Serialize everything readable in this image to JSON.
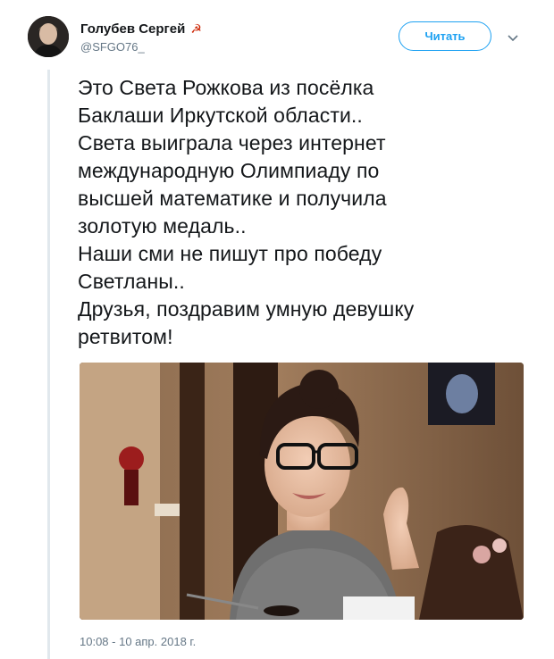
{
  "author": {
    "name": "Голубев Сергей",
    "name_symbol": "☭",
    "handle": "@SFGO76_"
  },
  "actions": {
    "follow_label": "Читать",
    "menu_icon": "chevron-down-icon"
  },
  "tweet": {
    "lines": [
      "Это Света Рожкова из посёлка",
      "Баклаши Иркутской области..",
      "Света выиграла через интернет",
      "международную Олимпиаду по",
      "высшей математике и получила",
      "золотую медаль..",
      "Наши сми не пишут про победу",
      "Светланы..",
      "Друзья, поздравим умную девушку",
      "ретвитом!"
    ],
    "timestamp": "10:08 - 10 апр. 2018 г."
  },
  "colors": {
    "accent": "#1da1f2",
    "secondary_text": "#657786",
    "thread_line": "#e1e8ed"
  }
}
